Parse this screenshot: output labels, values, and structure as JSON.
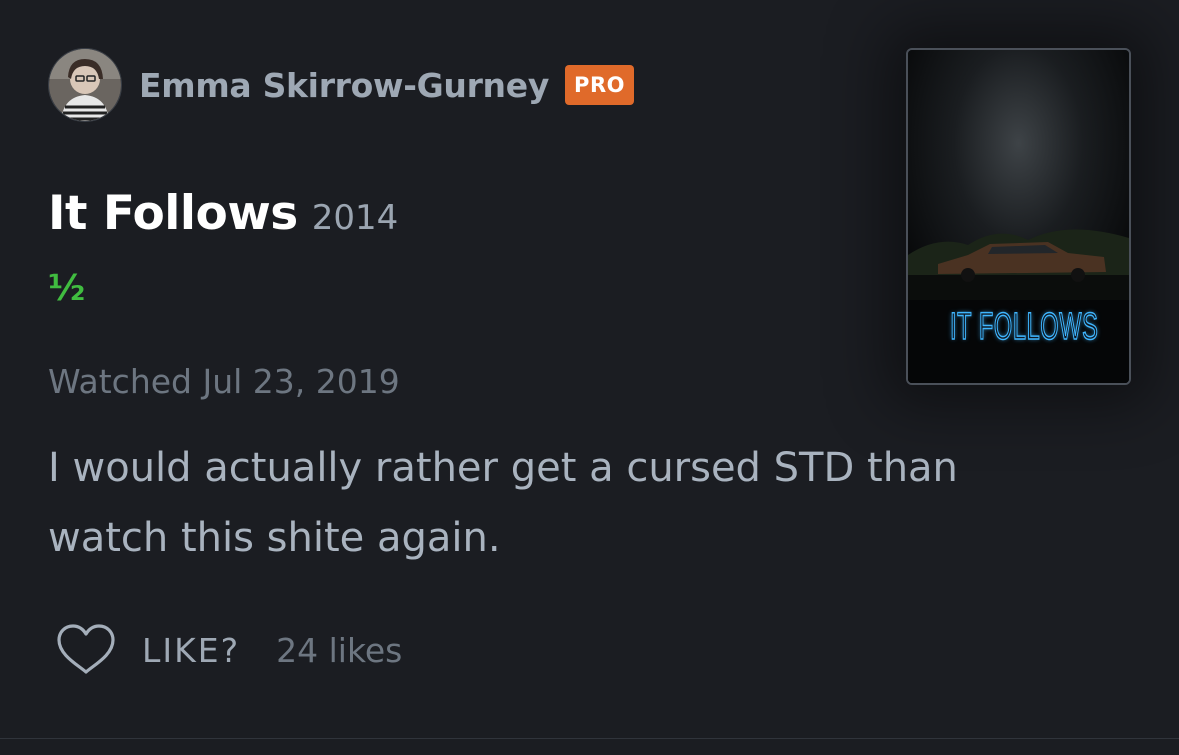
{
  "reviewer": {
    "name": "Emma Skirrow-Gurney",
    "badge": "PRO",
    "avatar_icon": "user-avatar"
  },
  "film": {
    "title": "It Follows",
    "year": "2014",
    "rating_display": "½",
    "rating_stars": 0.5,
    "poster_title": "IT FOLLOWS"
  },
  "watched": "Watched Jul 23, 2019",
  "review": "I would actually rather get a cursed STD than watch this shite again.",
  "actions": {
    "like_label": "LIKE?",
    "like_icon": "heart-outline-icon",
    "likes_count": "24 likes"
  },
  "colors": {
    "background": "#1b1d22",
    "pro_badge": "#e06a2a",
    "rating_green": "#40bc40",
    "poster_neon": "#3fb6ff"
  }
}
